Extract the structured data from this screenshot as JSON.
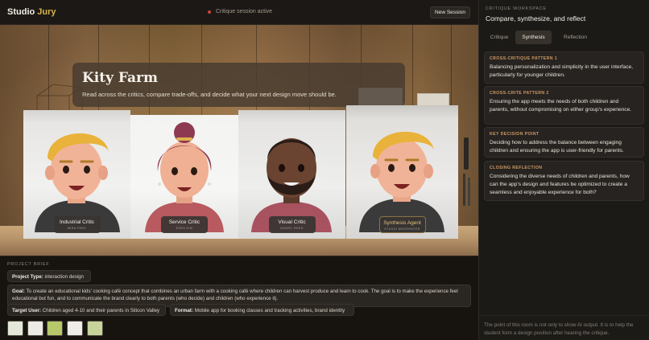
{
  "header": {
    "brand_main": "Studio",
    "brand_accent": "Jury",
    "session_status": "Critique session active",
    "new_session_label": "New Session"
  },
  "intro": {
    "title": "Kity Farm",
    "text": "Read across the critics, compare trade-offs, and decide what your next design move should be."
  },
  "critics": [
    {
      "name": "Industrial Critic",
      "sub": "MIRA PARK"
    },
    {
      "name": "Service Critic",
      "sub": "EZRA KIM"
    },
    {
      "name": "Visual Critic",
      "sub": "DANIEL REED"
    },
    {
      "name": "Synthesis Agent",
      "sub": "STUDIO MODERATOR"
    }
  ],
  "brief": {
    "heading": "PROJECT BRIEF",
    "type_label": "Project Type:",
    "type_value": "interaction design",
    "goal_label": "Goal:",
    "goal_value": "To create an educational kids' cooking café concept that combines an urban farm with a cooking café where children can harvest produce and learn to cook. The goal is to make the experience feel educational but fun, and to communicate the brand clearly to both parents (who decide) and children (who experience it).",
    "user_label": "Target User:",
    "user_value": "Children aged 4-10 and their parents in Silicon Valley",
    "format_label": "Format:",
    "format_value": "Mobile app for booking classes and tracking activities, brand identity"
  },
  "workspace": {
    "label": "CRITIQUE WORKSPACE",
    "title": "Compare, synthesize, and reflect",
    "tabs": [
      "Critique",
      "Synthesis",
      "Reflection"
    ],
    "active_tab": "Synthesis",
    "cards": [
      {
        "title": "CROSS-CRITIQUE PATTERN 1",
        "body": "Balancing personalization and simplicity in the user interface, particularly for younger children."
      },
      {
        "title": "CROSS-CRITE PATTERN 2",
        "body": "Ensuring the app meets the needs of both children and parents, without compromising on either group's experience."
      },
      {
        "title": "KEY DECISION POINT",
        "body": "Deciding how to address the balance between engaging children and ensuring the app is user-friendly for parents."
      },
      {
        "title": "CLOSING REFLECTION",
        "body": "Considering the diverse needs of children and parents, how can the app's design and features be optimized to create a seamless and enjoyable experience for both?"
      }
    ],
    "footer_note": "The point of this room is not only to show AI output. It is to help the student form a design position after hearing the critique."
  },
  "colors": {
    "accent_gold": "#d9b44a",
    "card_title": "#cf9a63",
    "status_dot": "#c9463c"
  }
}
